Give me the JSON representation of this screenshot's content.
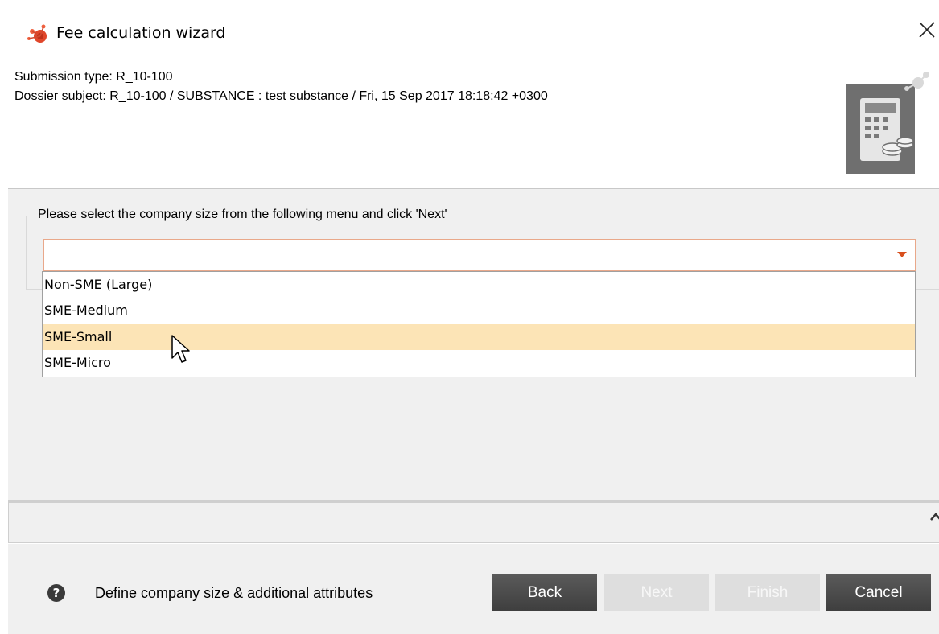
{
  "window": {
    "title": "Fee calculation wizard",
    "icons": {
      "app": "wizard-logo-icon",
      "close": "close-icon",
      "banner": "calculator-icon"
    }
  },
  "header": {
    "submission_type": "Submission type: R_10-100",
    "dossier_subject": "Dossier subject: R_10-100 / SUBSTANCE : test substance / Fri, 15 Sep 2017 18:18:42 +0300"
  },
  "form": {
    "legend": "Please select the company size from the following menu and click 'Next'",
    "company_size": {
      "selected_value": "",
      "options": [
        "Non-SME (Large)",
        "SME-Medium",
        "SME-Small",
        "SME-Micro"
      ],
      "highlighted_option": "SME-Small"
    }
  },
  "footer": {
    "help_icon_label": "?",
    "help_text": "Define company size & additional attributes",
    "buttons": {
      "back": "Back",
      "next": "Next",
      "finish": "Finish",
      "cancel": "Cancel"
    }
  },
  "colors": {
    "accent_orange": "#d8501e",
    "highlight": "#fce4b6",
    "button_active": "#4a4a4a",
    "button_disabled": "#dedede"
  }
}
